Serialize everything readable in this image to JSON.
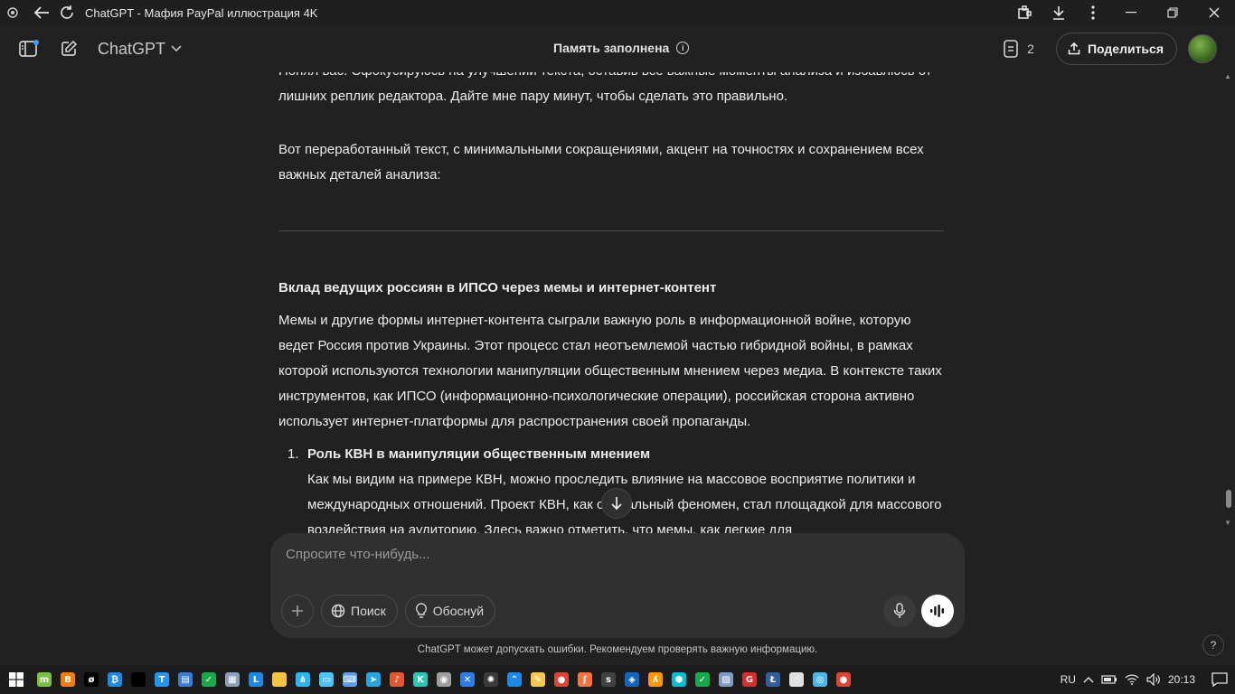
{
  "window": {
    "title": "ChatGPT - Мафия PayPal иллюстрация 4K"
  },
  "header": {
    "model": "ChatGPT",
    "memory_status": "Память заполнена",
    "doc_count": "2",
    "share_label": "Поделиться"
  },
  "chat": {
    "para1": "Понял вас. Сфокусируюсь на улучшении текста, оставив все важные моменты анализа и избавлюсь от лишних реплик редактора. Дайте мне пару минут, чтобы сделать это правильно.",
    "para2": "Вот переработанный текст, с минимальными сокращениями, акцент на точностях и сохранением всех важных деталей анализа:",
    "heading": "Вклад ведущих россиян в ИПСО через мемы и интернет-контент",
    "para3": "Мемы и другие формы интернет-контента сыграли важную роль в информационной войне, которую ведет Россия против Украины. Этот процесс стал неотъемлемой частью гибридной войны, в рамках которой используются технологии манипуляции общественным мнением через медиа. В контексте таких инструментов, как ИПСО (информационно-психологические операции), российская сторона активно использует интернет-платформы для распространения своей пропаганды.",
    "list_number": "1.",
    "list_title": "Роль КВН в манипуляции общественным мнением",
    "list_body": "Как мы видим на примере КВН, можно проследить влияние на массовое восприятие политики и международных отношений. Проект КВН, как социальный феномен, стал площадкой для массового воздействия на аудиторию. Здесь важно отметить, что мемы, как легкие для"
  },
  "composer": {
    "placeholder": "Спросите что-нибудь...",
    "search_label": "Поиск",
    "reason_label": "Обоснуй"
  },
  "footer": {
    "disclaimer": "ChatGPT может допускать ошибки. Рекомендуем проверять важную информацию.",
    "help": "?"
  },
  "taskbar": {
    "language": "RU",
    "time": "20:13",
    "apps": [
      {
        "icon": "m-app-icon",
        "color": "#7cc242",
        "glyph": "m"
      },
      {
        "icon": "blogger-icon",
        "color": "#f57d00",
        "glyph": "B"
      },
      {
        "icon": "black-app-icon",
        "color": "#000000",
        "glyph": "ø"
      },
      {
        "icon": "bitcoin-app-icon",
        "color": "#1e88e5",
        "glyph": "₿"
      },
      {
        "icon": "black-square-icon",
        "color": "#000000",
        "glyph": ""
      },
      {
        "icon": "translate-icon",
        "color": "#2196f3",
        "glyph": "T"
      },
      {
        "icon": "window-app-icon",
        "color": "#3a7bd5",
        "glyph": "▤"
      },
      {
        "icon": "check-app-icon",
        "color": "#19a84a",
        "glyph": "✓"
      },
      {
        "icon": "image-viewer-icon",
        "color": "#8aa0b6",
        "glyph": "▦"
      },
      {
        "icon": "l-app-icon",
        "color": "#1e88e5",
        "glyph": "L"
      },
      {
        "icon": "folder-icon",
        "color": "#f4c542",
        "glyph": ""
      },
      {
        "icon": "network-app-icon",
        "color": "#29b6f6",
        "glyph": "⋔"
      },
      {
        "icon": "monitor-app-icon",
        "color": "#4fc3f7",
        "glyph": "▭"
      },
      {
        "icon": "keyboard-app-icon",
        "color": "#5c9ded",
        "glyph": "⌨"
      },
      {
        "icon": "telegram-icon",
        "color": "#2aa3e0",
        "glyph": "➤"
      },
      {
        "icon": "music-app-icon",
        "color": "#e2572f",
        "glyph": "♪"
      },
      {
        "icon": "k-app-icon",
        "color": "#2ec4b6",
        "glyph": "K"
      },
      {
        "icon": "eye-app-icon",
        "color": "#9e9e9e",
        "glyph": "◉"
      },
      {
        "icon": "tools-app-icon",
        "color": "#2f7de1",
        "glyph": "✕"
      },
      {
        "icon": "chatgpt-taskbar-icon",
        "color": "#3a3a3a",
        "glyph": "✺"
      },
      {
        "icon": "up-app-icon",
        "color": "#1e88e5",
        "glyph": "⌃"
      },
      {
        "icon": "notes-app-icon",
        "color": "#f2c94c",
        "glyph": "✎"
      },
      {
        "icon": "chrome-icon",
        "color": "#db4437",
        "glyph": "●"
      },
      {
        "icon": "feather-app-icon",
        "color": "#ff7043",
        "glyph": "ʃ"
      },
      {
        "icon": "s-app-icon",
        "color": "#424242",
        "glyph": "s"
      },
      {
        "icon": "shield-app-icon",
        "color": "#1565c0",
        "glyph": "◈"
      },
      {
        "icon": "fox-app-icon",
        "color": "#ff9800",
        "glyph": "ʎ"
      },
      {
        "icon": "cube-app-icon",
        "color": "#00bcd4",
        "glyph": "⬢"
      },
      {
        "icon": "check2-app-icon",
        "color": "#19a84a",
        "glyph": "✓"
      },
      {
        "icon": "photo-app-icon",
        "color": "#7e9cc3",
        "glyph": "▨"
      },
      {
        "icon": "g-app-icon",
        "color": "#d32f2f",
        "glyph": "G"
      },
      {
        "icon": "litecoin-icon",
        "color": "#345d9d",
        "glyph": "Ł"
      },
      {
        "icon": "hand-app-icon",
        "color": "#e0e0e0",
        "glyph": "☝"
      },
      {
        "icon": "circle-app-icon",
        "color": "#4db6e8",
        "glyph": "◎"
      },
      {
        "icon": "chrome2-icon",
        "color": "#db4437",
        "glyph": "●"
      }
    ]
  },
  "colors": {
    "background": "#212121",
    "composer": "#303030",
    "text": "#ececec"
  }
}
